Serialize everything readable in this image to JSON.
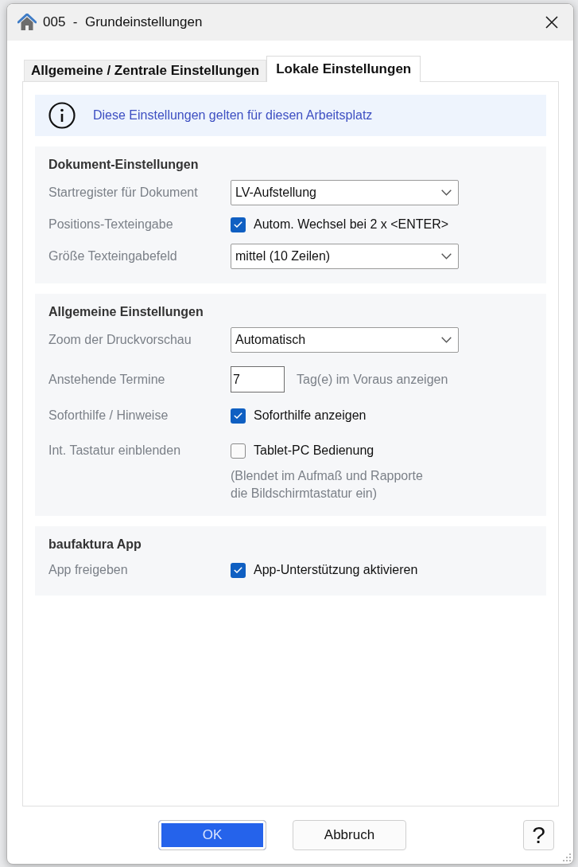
{
  "window": {
    "title": "005  -  Grundeinstellungen"
  },
  "tabs": [
    {
      "label": "Allgemeine / Zentrale Einstellungen",
      "selected": false
    },
    {
      "label": "Lokale Einstellungen",
      "selected": true
    }
  ],
  "info_banner": {
    "text": "Diese Einstellungen gelten für diesen Arbeitsplatz"
  },
  "sections": [
    {
      "heading": "Dokument-Einstellungen",
      "rows": [
        {
          "kind": "dropdown",
          "label": "Startregister für Dokument",
          "value": "LV-Aufstellung"
        },
        {
          "kind": "checkbox",
          "label": "Positions-Texteingabe",
          "option": "Autom. Wechsel bei 2 x <ENTER>",
          "checked": true
        },
        {
          "kind": "dropdown",
          "label": "Größe Texteingabefeld",
          "value": "mittel (10 Zeilen)"
        }
      ]
    },
    {
      "heading": "Allgemeine Einstellungen",
      "rows": [
        {
          "kind": "dropdown",
          "label": "Zoom der Druckvorschau",
          "value": "Automatisch"
        },
        {
          "kind": "number",
          "label": "Anstehende Termine",
          "value": "7",
          "suffix": "Tag(e) im Voraus anzeigen"
        },
        {
          "kind": "checkbox",
          "label": "Soforthilfe / Hinweise",
          "option": "Soforthilfe anzeigen",
          "checked": true
        },
        {
          "kind": "checkbox",
          "label": "Int. Tastatur einblenden",
          "option": "Tablet-PC Bedienung",
          "checked": false,
          "note": "(Blendet im Aufmaß und Rapporte die Bildschirmtastatur ein)"
        }
      ]
    },
    {
      "heading": "baufaktura App",
      "rows": [
        {
          "kind": "checkbox",
          "label": "App freigeben",
          "option": "App-Unterstützung aktivieren",
          "checked": true
        }
      ]
    }
  ],
  "buttons": [
    {
      "label": "OK",
      "kind": "primary"
    },
    {
      "label": "Abbruch",
      "kind": "secondary"
    },
    {
      "label": "?",
      "kind": "help"
    }
  ]
}
